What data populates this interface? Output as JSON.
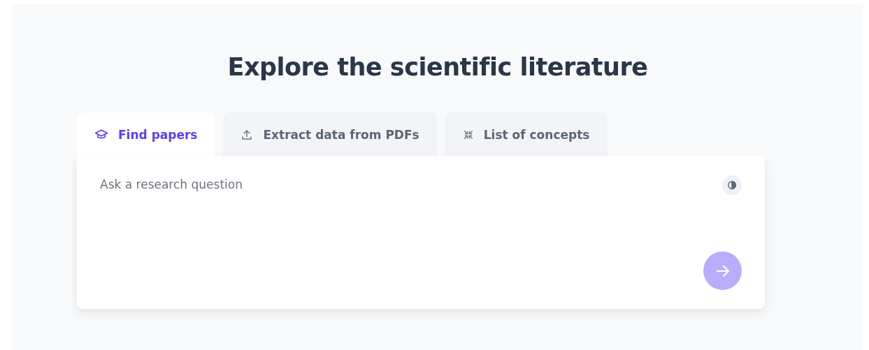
{
  "heading": "Explore the scientific literature",
  "tabs": [
    {
      "label": "Find papers",
      "kind": "cap",
      "selected": true
    },
    {
      "label": "Extract data from PDFs",
      "kind": "upload",
      "selected": false
    },
    {
      "label": "List of concepts",
      "kind": "collapse",
      "selected": false
    }
  ],
  "query": {
    "placeholder": "Ask a research question"
  },
  "submit": {
    "disabled": true
  }
}
